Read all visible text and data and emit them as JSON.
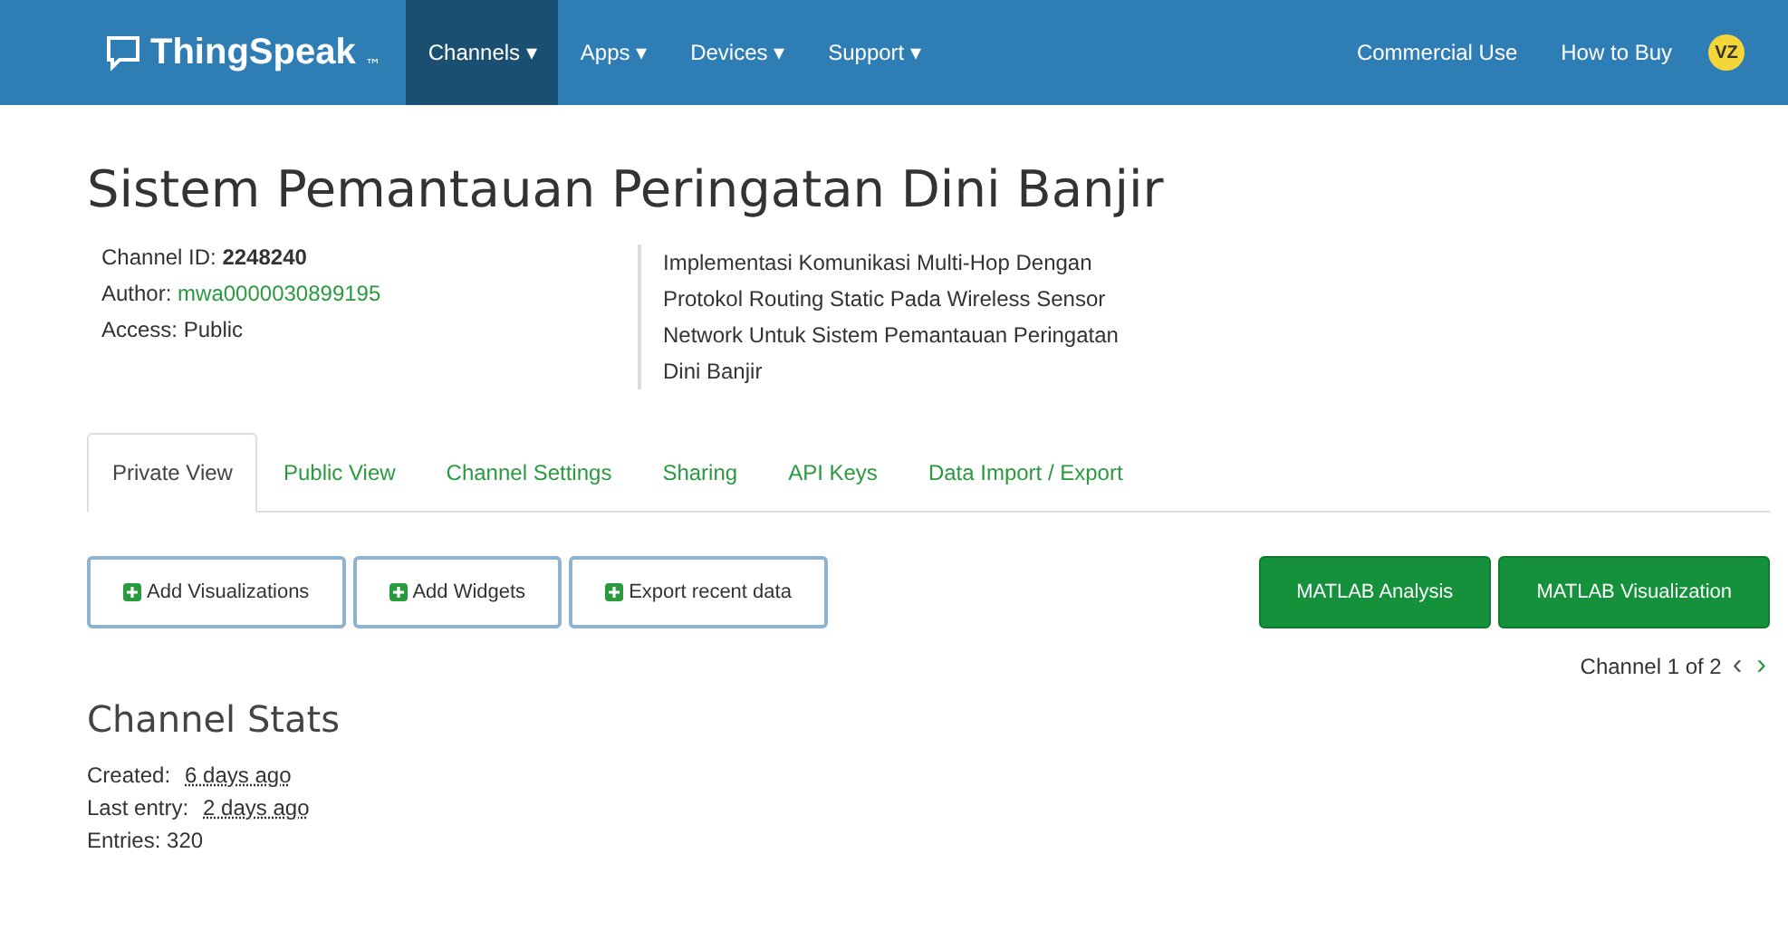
{
  "navbar": {
    "logo": "ThingSpeak",
    "trademark": "™",
    "menu": [
      {
        "label": "Channels",
        "caret": "▾",
        "selected": true
      },
      {
        "label": "Apps",
        "caret": "▾",
        "selected": false
      },
      {
        "label": "Devices",
        "caret": "▾",
        "selected": false
      },
      {
        "label": "Support",
        "caret": "▾",
        "selected": false
      }
    ],
    "right_links": [
      "Commercial Use",
      "How to Buy"
    ],
    "avatar": "VZ"
  },
  "channel": {
    "title": "Sistem Pemantauan Peringatan Dini Banjir",
    "id_label": "Channel ID:",
    "id": "2248240",
    "author_label": "Author:",
    "author": "mwa0000030899195",
    "access": "Access: Public",
    "description": "Implementasi Komunikasi Multi-Hop Dengan Protokol Routing Static Pada Wireless Sensor Network Untuk Sistem Pemantauan Peringatan Dini Banjir"
  },
  "tabs": [
    {
      "label": "Private View",
      "selected": true
    },
    {
      "label": "Public View",
      "selected": false
    },
    {
      "label": "Channel Settings",
      "selected": false
    },
    {
      "label": "Sharing",
      "selected": false
    },
    {
      "label": "API Keys",
      "selected": false
    },
    {
      "label": "Data Import / Export",
      "selected": false
    }
  ],
  "actions": [
    {
      "label": "Add Visualizations",
      "kind": "outline"
    },
    {
      "label": "Add Widgets",
      "kind": "outline"
    },
    {
      "label": "Export recent data",
      "kind": "outline"
    },
    {
      "label": "MATLAB Analysis",
      "kind": "solid"
    },
    {
      "label": "MATLAB Visualization",
      "kind": "solid"
    }
  ],
  "pager": {
    "text": "Channel 1 of 2",
    "prev": "‹",
    "next": "›"
  },
  "stats": {
    "title": "Channel Stats",
    "created_label": "Created:",
    "created": "6 days ago",
    "last_label": "Last entry:",
    "last": "2 days ago",
    "entries": "Entries: 320"
  }
}
